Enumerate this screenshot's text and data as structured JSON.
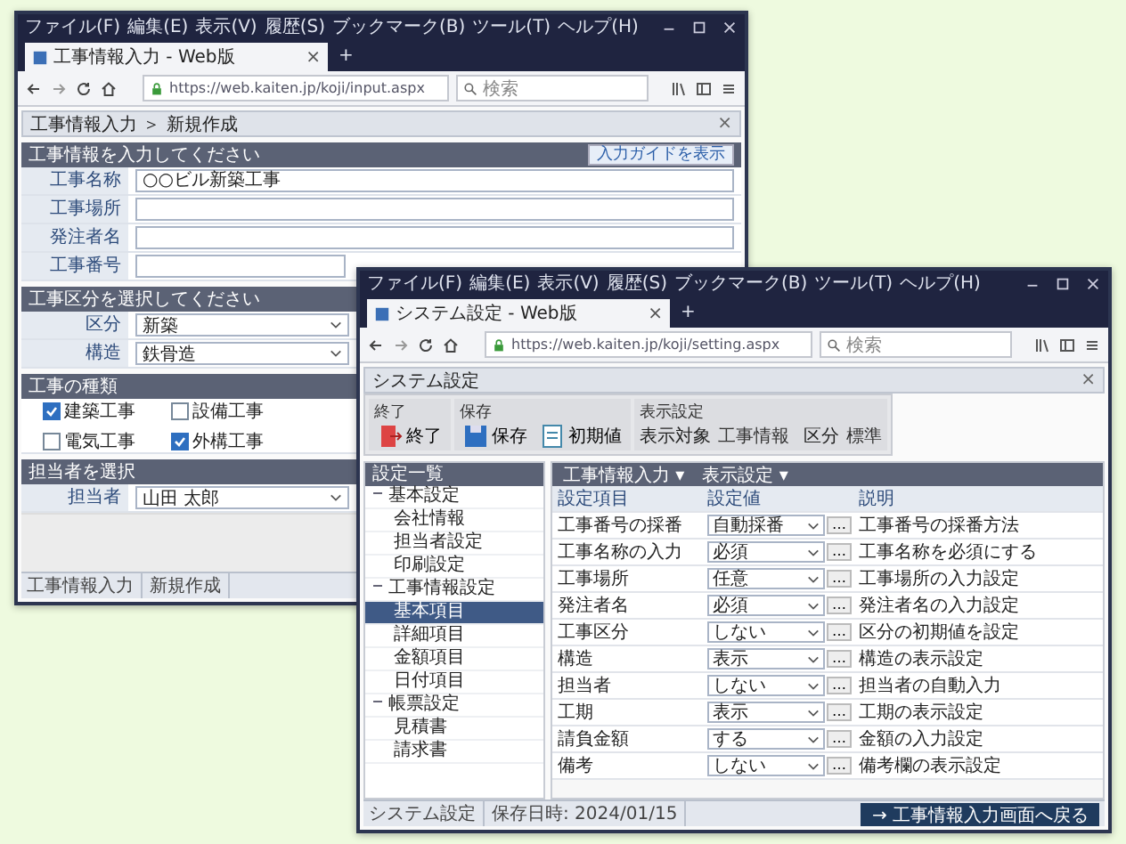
{
  "back_window": {
    "menu": [
      "ファイル(F)",
      "編集(E)",
      "表示(V)",
      "履歴(S)",
      "ブックマーク(B)",
      "ツール(T)",
      "ヘルプ(H)"
    ],
    "tab": {
      "title": "工事情報入力 - Web版",
      "close": "×"
    },
    "new_tab": "+",
    "url": "https://web.kaiten.jp/koji/input.aspx",
    "search_placeholder": "検索",
    "breadcrumb": "工事情報入力 ＞ 新規作成",
    "close_label": "×",
    "info_section": {
      "title": "工事情報を入力してください",
      "help_button": "入力ガイドを表示",
      "fields": [
        {
          "label": "工事名称",
          "value": "○○ビル新築工事"
        },
        {
          "label": "工事場所"
        },
        {
          "label": "発注者名"
        },
        {
          "label": "工事番号"
        }
      ]
    },
    "category_section": {
      "title": "工事区分を選択してください",
      "rows": [
        {
          "label": "区分",
          "value": "新築"
        },
        {
          "label": "構造",
          "value": "鉄骨造"
        }
      ]
    },
    "type_section": {
      "title": "工事の種類",
      "items": [
        {
          "label": "建築工事",
          "checked": true
        },
        {
          "label": "設備工事",
          "checked": false
        },
        {
          "label": "電気工事",
          "checked": false
        },
        {
          "label": "外構工事",
          "checked": true
        }
      ]
    },
    "staff_section": {
      "title": "担当者を選択",
      "rows": [
        {
          "label": "担当者",
          "value": "山田 太郎"
        }
      ]
    },
    "status": [
      "工事情報入力",
      "新規作成"
    ]
  },
  "front_window": {
    "menu": [
      "ファイル(F)",
      "編集(E)",
      "表示(V)",
      "履歴(S)",
      "ブックマーク(B)",
      "ツール(T)",
      "ヘルプ(H)"
    ],
    "tab": {
      "title": "システム設定 - Web版",
      "close": "×"
    },
    "new_tab": "+",
    "url": "https://web.kaiten.jp/koji/setting.aspx",
    "search_placeholder": "検索",
    "app_title": "システム設定",
    "close_label": "×",
    "ribbon": [
      {
        "title": "終了",
        "buttons": [
          {
            "label": "終了"
          }
        ]
      },
      {
        "title": "保存",
        "buttons": [
          {
            "label": "保存"
          },
          {
            "label": "初期値"
          }
        ]
      },
      {
        "title": "表示設定",
        "rows": [
          {
            "label": "表示対象",
            "value": "工事情報"
          },
          {
            "label": "区分",
            "value": "標準"
          }
        ]
      }
    ],
    "tree_title": "設定一覧",
    "tree": [
      {
        "label": "基本設定",
        "expanded": true,
        "selected": false,
        "children": [
          {
            "label": "会社情報",
            "selected": false
          },
          {
            "label": "担当者設定",
            "selected": false
          },
          {
            "label": "印刷設定",
            "selected": false
          }
        ]
      },
      {
        "label": "工事情報設定",
        "expanded": true,
        "selected": false,
        "children": [
          {
            "label": "基本項目",
            "selected": true
          },
          {
            "label": "詳細項目",
            "selected": false
          },
          {
            "label": "金額項目",
            "selected": false
          },
          {
            "label": "日付項目",
            "selected": false
          }
        ]
      },
      {
        "label": "帳票設定",
        "expanded": true,
        "selected": false,
        "children": [
          {
            "label": "見積書",
            "selected": false
          },
          {
            "label": "請求書",
            "selected": false
          }
        ]
      }
    ],
    "toolbar": [
      "工事情報入力 ▾",
      "表示設定 ▾"
    ],
    "columns": [
      "設定項目",
      "設定値",
      "説明"
    ],
    "rows": [
      {
        "item": "工事番号の採番",
        "value": "自動採番",
        "button": "…",
        "description": "工事番号の採番方法"
      },
      {
        "item": "工事名称の入力",
        "value": "必須",
        "button": "…",
        "description": "工事名称を必須にする"
      },
      {
        "item": "工事場所",
        "value": "任意",
        "button": "…",
        "description": "工事場所の入力設定"
      },
      {
        "item": "発注者名",
        "value": "必須",
        "button": "…",
        "description": "発注者名の入力設定"
      },
      {
        "item": "工事区分",
        "value": "しない",
        "button": "…",
        "description": "区分の初期値を設定"
      },
      {
        "item": "構造",
        "value": "表示",
        "button": "…",
        "description": "構造の表示設定"
      },
      {
        "item": "担当者",
        "value": "しない",
        "button": "…",
        "description": "担当者の自動入力"
      },
      {
        "item": "工期",
        "value": "表示",
        "button": "…",
        "description": "工期の表示設定"
      },
      {
        "item": "請負金額",
        "value": "する",
        "button": "…",
        "description": "金額の入力設定"
      },
      {
        "item": "備考",
        "value": "しない",
        "button": "…",
        "description": "備考欄の表示設定"
      }
    ],
    "status": [
      "システム設定",
      "保存日時: 2024/01/15"
    ],
    "return_button": "→ 工事情報入力画面へ戻る"
  }
}
